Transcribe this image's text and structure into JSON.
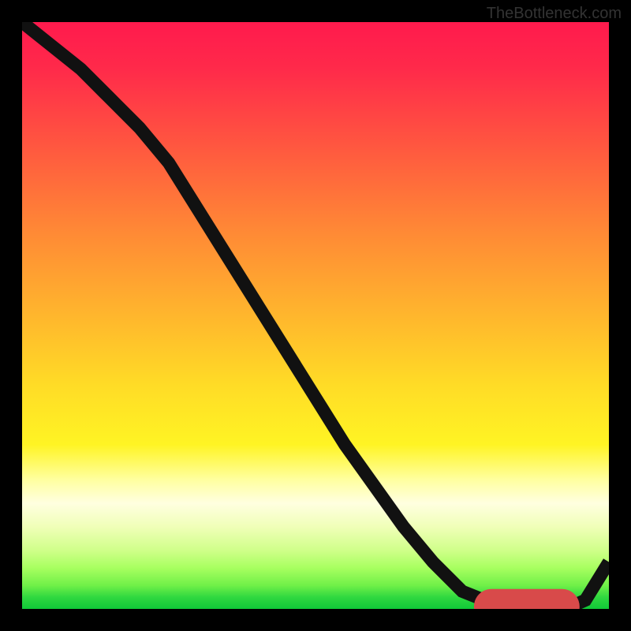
{
  "attribution": "TheBottleneck.com",
  "chart_data": {
    "type": "line",
    "title": "",
    "xlabel": "",
    "ylabel": "",
    "x": [
      0,
      5,
      10,
      15,
      20,
      25,
      30,
      35,
      40,
      45,
      50,
      55,
      60,
      65,
      70,
      75,
      80,
      82,
      84,
      86,
      88,
      90,
      92,
      94,
      96,
      100
    ],
    "values": [
      100,
      96,
      92,
      87,
      82,
      76,
      68,
      60,
      52,
      44,
      36,
      28,
      21,
      14,
      8,
      3,
      1,
      0.5,
      0.4,
      0.3,
      0.3,
      0.3,
      0.4,
      0.6,
      1.5,
      8
    ],
    "xlim": [
      0,
      100
    ],
    "ylim": [
      0,
      100
    ],
    "markers": {
      "x_range": [
        80,
        92
      ],
      "y": 0.4,
      "note": "optimal zone markers"
    }
  },
  "colors": {
    "background_frame": "#000000",
    "gradient_top": "#ff1a4d",
    "gradient_bottom": "#10c838",
    "line": "#111111",
    "marker": "#d84a4a"
  }
}
